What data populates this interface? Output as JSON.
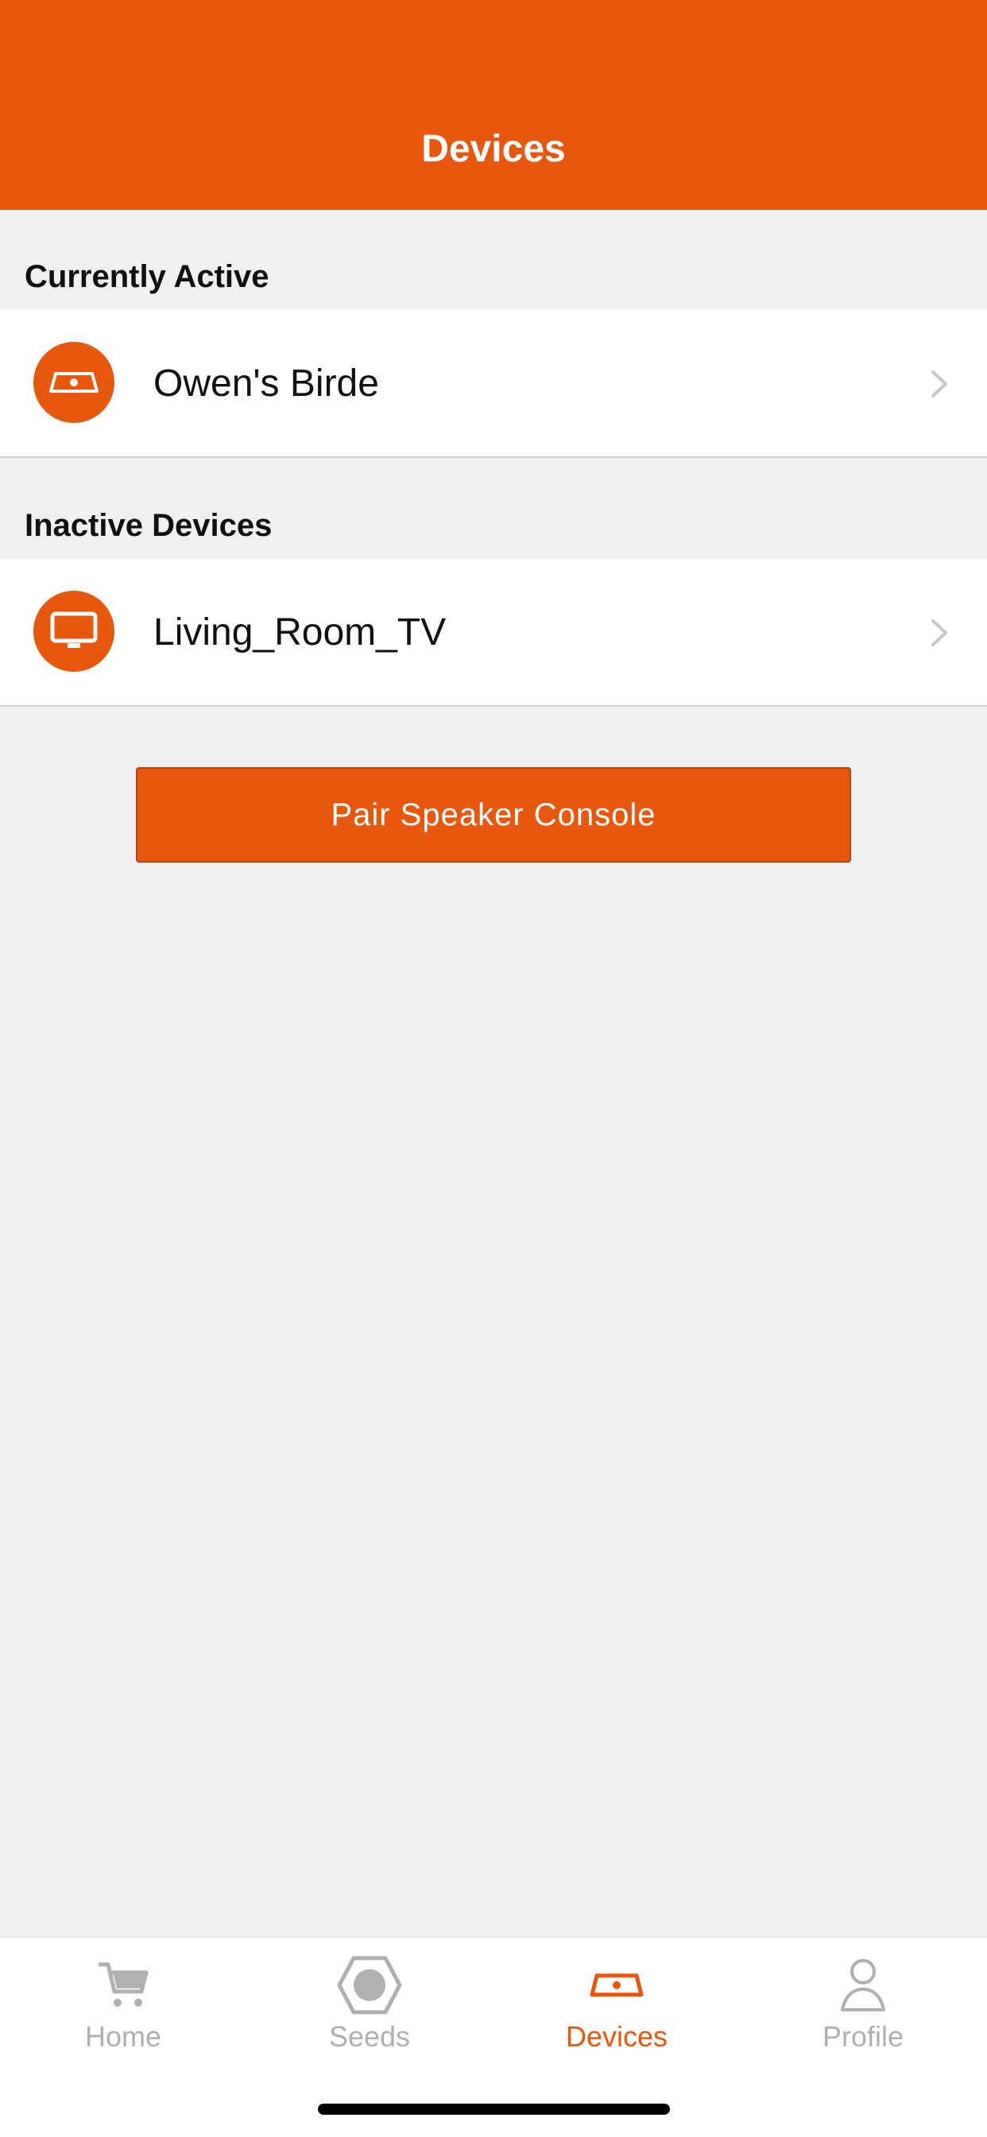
{
  "header": {
    "title": "Devices"
  },
  "sections": {
    "active": {
      "title": "Currently Active",
      "device": {
        "name": "Owen's Birde",
        "icon": "birde-device-icon"
      }
    },
    "inactive": {
      "title": "Inactive Devices",
      "device": {
        "name": "Living_Room_TV",
        "icon": "tv-icon"
      }
    }
  },
  "pair_button": {
    "label": "Pair Speaker Console"
  },
  "tabbar": {
    "tabs": [
      {
        "label": "Home",
        "icon": "cart-icon",
        "active": false
      },
      {
        "label": "Seeds",
        "icon": "seed-pod-icon",
        "active": false
      },
      {
        "label": "Devices",
        "icon": "birde-device-icon",
        "active": true
      },
      {
        "label": "Profile",
        "icon": "person-icon",
        "active": false
      }
    ]
  },
  "colors": {
    "accent": "#e8570e",
    "background": "#f0f0f0",
    "inactive_tab": "#b0b0b0"
  }
}
